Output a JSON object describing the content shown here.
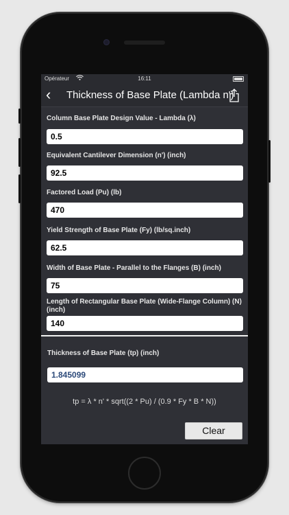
{
  "status_bar": {
    "carrier": "Opérateur",
    "wifi_icon": "wifi-icon",
    "time": "16:11",
    "battery_icon": "battery-icon"
  },
  "nav": {
    "back_icon": "chevron-left-icon",
    "back_glyph": "‹",
    "title": "Thickness of Base Plate (Lambda n')",
    "share_icon": "share-icon"
  },
  "form": {
    "lambda": {
      "label": "Column Base Plate Design Value - Lambda (λ)",
      "value": "0.5"
    },
    "cantilever": {
      "label": "Equivalent Cantilever Dimension (n') (inch)",
      "value": "92.5"
    },
    "load": {
      "label": "Factored Load (Pu) (lb)",
      "value": "470"
    },
    "yield": {
      "label": "Yield Strength of Base Plate (Fy) (lb/sq.inch)",
      "value": "62.5"
    },
    "width": {
      "label": "Width of Base Plate - Parallel to the Flanges (B) (inch)",
      "value": "75"
    },
    "length": {
      "label": "Length of Rectangular Base Plate (Wide-Flange Column) (N) (inch)",
      "value": "140"
    }
  },
  "result": {
    "label": "Thickness of Base Plate (tp) (inch)",
    "value": "1.845099",
    "formula": "tp = λ * n' * sqrt((2 * Pu) / (0.9 * Fy * B * N))"
  },
  "actions": {
    "clear_label": "Clear"
  },
  "colors": {
    "screen_background": "#2f3036",
    "result_text": "#2c4a7a"
  }
}
